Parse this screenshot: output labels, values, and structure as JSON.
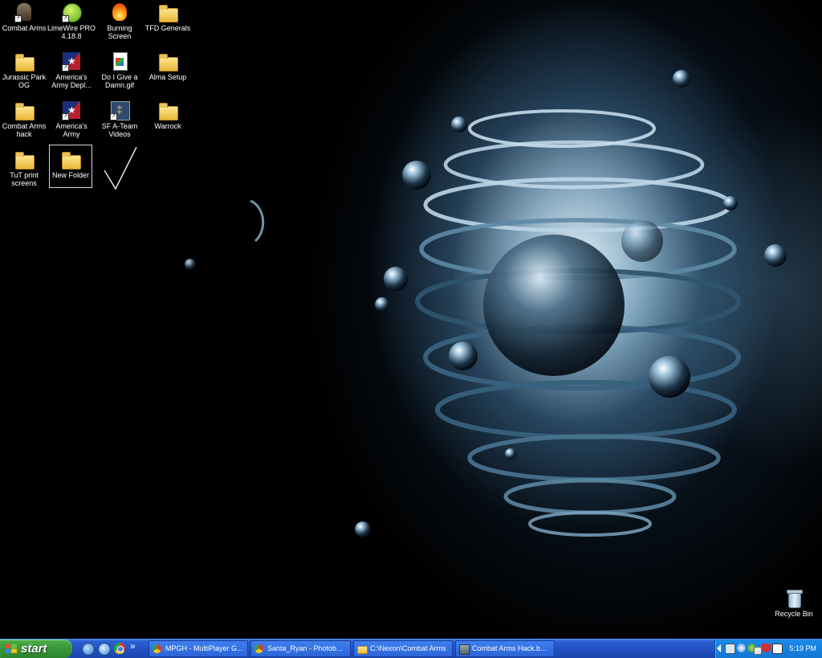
{
  "desktop": {
    "icons": [
      {
        "label": "Combat Arms"
      },
      {
        "label": "LimeWire PRO 4.18.8"
      },
      {
        "label": "Burning Screen"
      },
      {
        "label": "TFD Generals"
      },
      {
        "label": "Jurassic Park OG"
      },
      {
        "label": "America's Army Depl..."
      },
      {
        "label": "Do I Give a Damn.gif"
      },
      {
        "label": "Alma Setup"
      },
      {
        "label": "Combat Arms hack"
      },
      {
        "label": "America's Army"
      },
      {
        "label": "SF A-Team Videos"
      },
      {
        "label": "Warrock"
      },
      {
        "label": "TuT print screens"
      },
      {
        "label": "New Folder"
      },
      {
        "label": "Recycle Bin"
      }
    ]
  },
  "taskbar": {
    "start_label": "start",
    "tasks": [
      {
        "label": "MPGH - MultiPlayer G..."
      },
      {
        "label": "Santa_Ryan - Photob..."
      },
      {
        "label": "C:\\Nexon\\Combat Arms"
      },
      {
        "label": "Combat Arms Hack.b..."
      }
    ],
    "quicklaunch_more": "»",
    "clock": "5:19 PM"
  },
  "colors": {
    "taskbar_blue": "#245edb",
    "start_green": "#3a9a3a",
    "tray_blue": "#1a8ae8"
  }
}
